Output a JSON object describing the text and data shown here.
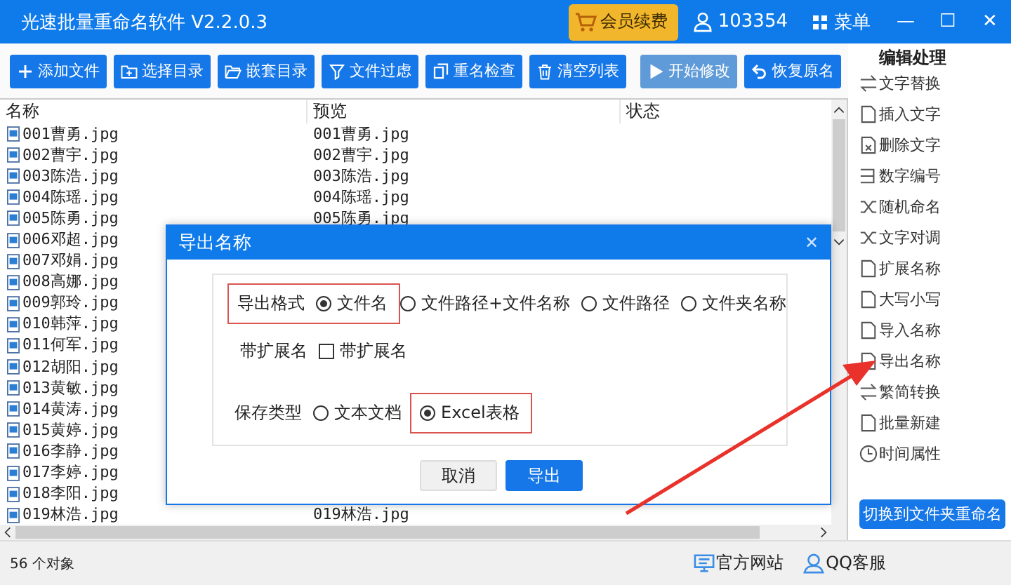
{
  "window": {
    "title": "光速批量重命名软件 V2.2.0.3",
    "vip_button": "会员续费",
    "user_id": "103354",
    "menu": "菜单",
    "controls": [
      "—",
      "☐",
      "✕"
    ]
  },
  "toolbar": [
    {
      "label": "添加文件",
      "disabled": false
    },
    {
      "label": "选择目录",
      "disabled": false
    },
    {
      "label": "嵌套目录",
      "disabled": false
    },
    {
      "label": "文件过虑",
      "disabled": false
    },
    {
      "label": "重名检查",
      "disabled": false
    },
    {
      "label": "清空列表",
      "disabled": false
    },
    {
      "label": "开始修改",
      "disabled": true
    },
    {
      "label": "恢复原名",
      "disabled": false
    }
  ],
  "table": {
    "columns": [
      "名称",
      "预览",
      "状态"
    ],
    "rows": [
      {
        "name": "001曹勇.jpg",
        "preview": "001曹勇.jpg"
      },
      {
        "name": "002曹宇.jpg",
        "preview": "002曹宇.jpg"
      },
      {
        "name": "003陈浩.jpg",
        "preview": "003陈浩.jpg"
      },
      {
        "name": "004陈瑶.jpg",
        "preview": "004陈瑶.jpg"
      },
      {
        "name": "005陈勇.jpg",
        "preview": "005陈勇.jpg"
      },
      {
        "name": "006邓超.jpg"
      },
      {
        "name": "007邓娟.jpg"
      },
      {
        "name": "008高娜.jpg"
      },
      {
        "name": "009郭玲.jpg"
      },
      {
        "name": "010韩萍.jpg"
      },
      {
        "name": "011何军.jpg"
      },
      {
        "name": "012胡阳.jpg"
      },
      {
        "name": "013黄敏.jpg"
      },
      {
        "name": "014黄涛.jpg"
      },
      {
        "name": "015黄婷.jpg"
      },
      {
        "name": "016李静.jpg"
      },
      {
        "name": "017李婷.jpg"
      },
      {
        "name": "018李阳.jpg"
      },
      {
        "name": "019林浩.jpg",
        "preview": "019林浩.jpg"
      }
    ]
  },
  "sidebar": {
    "title": "编辑处理",
    "items": [
      {
        "label": "文字替换"
      },
      {
        "label": "插入文字"
      },
      {
        "label": "删除文字"
      },
      {
        "label": "数字编号"
      },
      {
        "label": "随机命名"
      },
      {
        "label": "文字对调"
      },
      {
        "label": "扩展名称"
      },
      {
        "label": "大写小写"
      },
      {
        "label": "导入名称"
      },
      {
        "label": "导出名称"
      },
      {
        "label": "繁简转换"
      },
      {
        "label": "批量新建"
      },
      {
        "label": "时间属性"
      }
    ],
    "switch_button": "切换到文件夹重命名"
  },
  "status_bar": {
    "count": "56 个对象",
    "links": [
      {
        "label": "官方网站"
      },
      {
        "label": "QQ客服"
      }
    ]
  },
  "dialog": {
    "title": "导出名称",
    "close": "✕",
    "rows": [
      {
        "items": [
          {
            "kind": "label",
            "text": "导出格式",
            "highlighted": true
          },
          {
            "kind": "radio",
            "text": "文件名",
            "selected": true,
            "highlighted": true
          },
          {
            "kind": "radio",
            "text": "文件路径+文件名称",
            "selected": false,
            "highlighted": false
          },
          {
            "kind": "radio",
            "text": "文件路径",
            "selected": false,
            "highlighted": false
          },
          {
            "kind": "radio",
            "text": "文件夹名称",
            "selected": false,
            "highlighted": false
          }
        ]
      },
      {
        "items": [
          {
            "kind": "label",
            "text": "带扩展名",
            "highlighted": false
          },
          {
            "kind": "checkbox",
            "text": "带扩展名",
            "checked": false,
            "highlighted": false
          }
        ]
      },
      {
        "items": [
          {
            "kind": "label",
            "text": "保存类型",
            "highlighted": false
          },
          {
            "kind": "radio",
            "text": "文本文档",
            "selected": false,
            "highlighted": false
          },
          {
            "kind": "radio",
            "text": "Excel表格",
            "selected": true,
            "highlighted": true
          }
        ]
      }
    ],
    "buttons": [
      {
        "label": "取消",
        "primary": false
      },
      {
        "label": "导出",
        "primary": true
      }
    ]
  }
}
